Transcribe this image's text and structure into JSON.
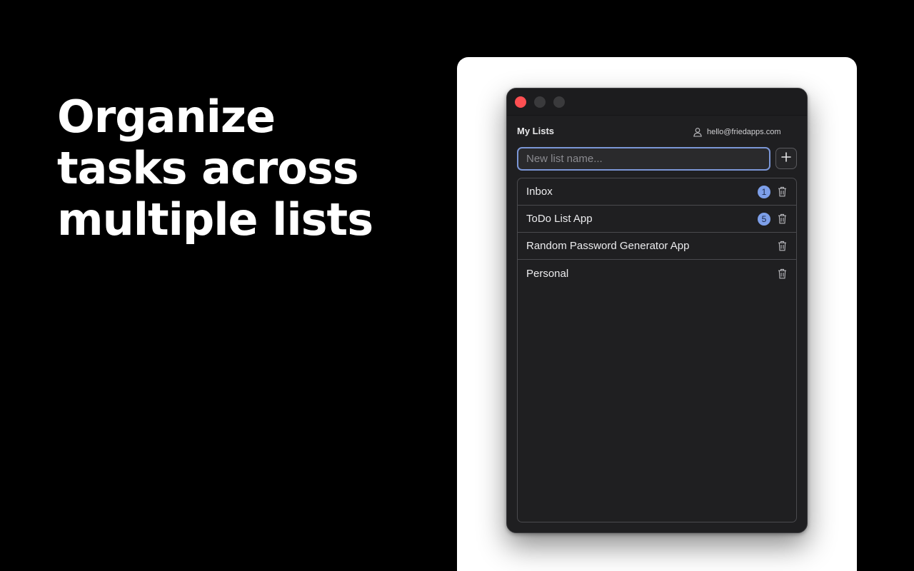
{
  "headline": {
    "lines": [
      "Organize",
      "tasks across",
      "multiple lists"
    ]
  },
  "window": {
    "header_title": "My Lists",
    "account_email": "hello@friedapps.com",
    "new_list_placeholder": "New list name...",
    "lists": [
      {
        "name": "Inbox",
        "count": "1"
      },
      {
        "name": "ToDo List App",
        "count": "5"
      },
      {
        "name": "Random Password Generator App",
        "count": ""
      },
      {
        "name": "Personal",
        "count": ""
      }
    ]
  },
  "colors": {
    "close_button": "#fe4f52",
    "accent_badge": "#7d9fe9",
    "input_focus_border": "#7b96d6"
  }
}
